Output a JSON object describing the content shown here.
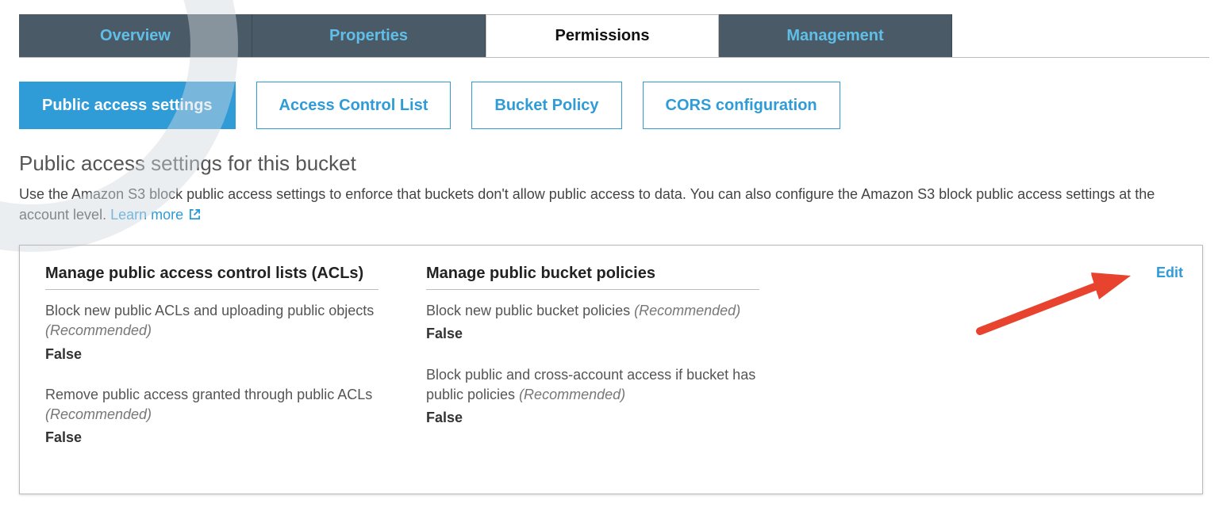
{
  "top_tabs": {
    "overview": "Overview",
    "properties": "Properties",
    "permissions": "Permissions",
    "management": "Management"
  },
  "sub_tabs": {
    "public_access_settings": "Public access settings",
    "acl": "Access Control List",
    "bucket_policy": "Bucket Policy",
    "cors": "CORS configuration"
  },
  "section": {
    "heading": "Public access settings for this bucket",
    "desc_1": "Use the Amazon S3 block public access settings to enforce that buckets don't allow public access to data. You can also configure the Amazon S3 block public access settings at the account level. ",
    "learn_more": "Learn more"
  },
  "panel": {
    "edit": "Edit",
    "acl_col": {
      "title": "Manage public access control lists (ACLs)",
      "items": [
        {
          "label": "Block new public ACLs and uploading public objects ",
          "rec": "(Recommended)",
          "value": "False"
        },
        {
          "label": "Remove public access granted through public ACLs ",
          "rec": "(Recommended)",
          "value": "False"
        }
      ]
    },
    "policy_col": {
      "title": "Manage public bucket policies",
      "items": [
        {
          "label": "Block new public bucket policies ",
          "rec": "(Recommended)",
          "value": "False"
        },
        {
          "label": "Block public and cross-account access if bucket has public policies ",
          "rec": "(Recommended)",
          "value": "False"
        }
      ]
    }
  },
  "colors": {
    "accent": "#2f9bd7",
    "tab_bg": "#4a5a66",
    "tab_fg": "#5fbfe8",
    "annotation_arrow": "#e8432e"
  }
}
